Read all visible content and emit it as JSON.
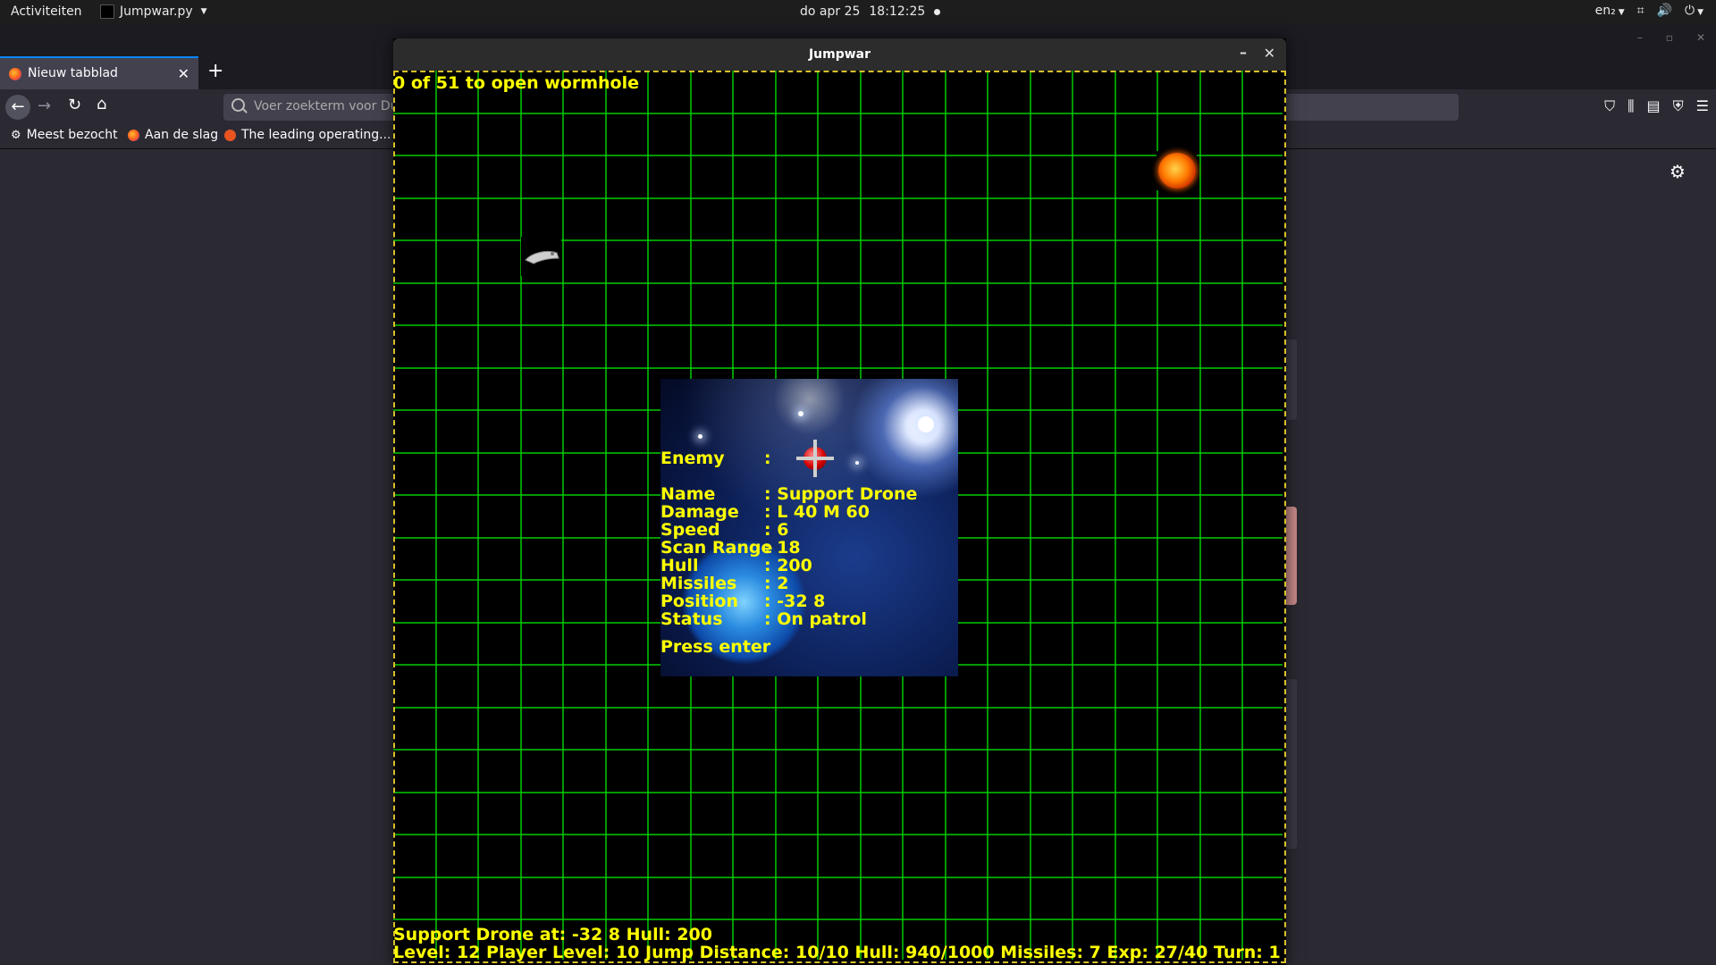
{
  "topbar": {
    "activities": "Activiteiten",
    "app_name": "Jumpwar.py",
    "date": "do apr 25",
    "time": "18:12:25",
    "lang": "en₂"
  },
  "firefox": {
    "tab_label": "Nieuw tabblad",
    "url_placeholder": "Voer zoekterm voor Du",
    "bookmarks": [
      "Meest bezocht",
      "Aan de slag",
      "The leading operating..."
    ]
  },
  "jumpwar": {
    "window_title": "Jumpwar",
    "wormhole_status": "0 of 51 to open wormhole",
    "info_panel": {
      "enemy_key": "Enemy",
      "enemy_sep": ":",
      "rows": [
        {
          "key": "Name",
          "value": ": Support Drone"
        },
        {
          "key": "Damage",
          "value": ": L 40 M 60"
        },
        {
          "key": "Speed",
          "value": ": 6"
        },
        {
          "key": "Scan Range",
          "value": ": 18"
        },
        {
          "key": "Hull",
          "value": ": 200"
        },
        {
          "key": "Missiles",
          "value": ": 2"
        },
        {
          "key": "Position",
          "value": ": -32 8"
        },
        {
          "key": "Status",
          "value": ": On patrol"
        }
      ],
      "prompt": "Press enter"
    },
    "target_line": "Support Drone at: -32 8 Hull: 200",
    "status_line": "Level: 12 Player Level: 10 Jump Distance: 10/10 Hull: 940/1000 Missiles: 7 Exp: 27/40 Turn: 1",
    "colors": {
      "grid": "#00cc00",
      "hud_text": "#ffff00",
      "border": "#d8c02a"
    }
  }
}
